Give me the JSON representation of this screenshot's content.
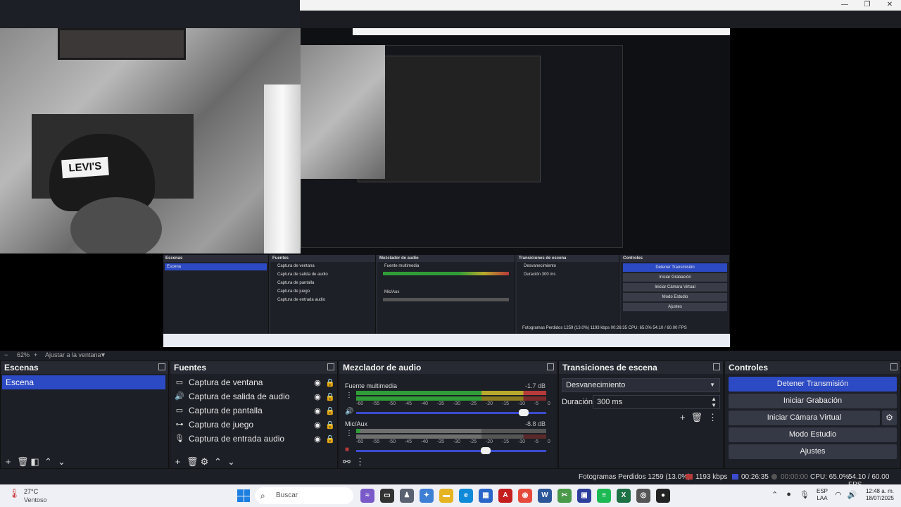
{
  "window": {
    "minimize": "—",
    "maximize": "❐",
    "close": "✕"
  },
  "preview": {
    "webcam_badge": "LEVI'S",
    "nested_docks": {
      "scenes_title": "Escenas",
      "scene": "Escena",
      "sources_title": "Fuentes",
      "sources": [
        "Captura de ventana",
        "Captura de salida de audio",
        "Captura de pantalla",
        "Captura de juego",
        "Captura de entrada audio"
      ],
      "mixer_title": "Mezclador de audio",
      "mixer_channels": [
        "Fuente multimedia",
        "Mic/Aux"
      ],
      "transitions_title": "Transiciones de escena",
      "transition": "Desvanecimiento",
      "duration": "Duración  300 ms",
      "controls_title": "Controles",
      "controls": [
        "Detener Transmisión",
        "Iniciar Grabación",
        "Iniciar Cámara Virtual",
        "Modo Estudio",
        "Ajustes"
      ],
      "status": "Fotogramas Perdidos 1259 (13.0%)   1193 kbps   00:26:35   CPU: 65.0%  54.10 / 60.00 FPS"
    }
  },
  "zoombar": {
    "minus": "−",
    "zoom": "62%",
    "plus": "+",
    "fit": "Ajustar a la ventana",
    "caret": "▼"
  },
  "scenes": {
    "title": "Escenas",
    "items": [
      "Escena"
    ]
  },
  "sources": {
    "title": "Fuentes",
    "items": [
      {
        "label": "Captura de ventana",
        "icon": "window-icon"
      },
      {
        "label": "Captura de salida de audio",
        "icon": "speaker-icon"
      },
      {
        "label": "Captura de pantalla",
        "icon": "monitor-icon"
      },
      {
        "label": "Captura de juego",
        "icon": "gamepad-icon"
      },
      {
        "label": "Captura de entrada audio",
        "icon": "microphone-icon"
      }
    ]
  },
  "mixer": {
    "title": "Mezclador de audio",
    "ticks": [
      "-60",
      "-55",
      "-50",
      "-45",
      "-40",
      "-35",
      "-30",
      "-25",
      "-20",
      "-15",
      "-10",
      "-5",
      "0"
    ],
    "channels": [
      {
        "name": "Fuente multimedia",
        "db": "-1.7 dB",
        "volume": 0.88
      },
      {
        "name": "Mic/Aux",
        "db": "-8.8 dB",
        "volume": 0.68
      }
    ]
  },
  "transitions": {
    "title": "Transiciones de escena",
    "selected": "Desvanecimiento",
    "duration_label": "Duración",
    "duration_value": "300 ms"
  },
  "controls": {
    "title": "Controles",
    "stop_stream": "Detener Transmisión",
    "start_recording": "Iniciar Grabación",
    "start_virtual_cam": "Iniciar Cámara Virtual",
    "studio_mode": "Modo Estudio",
    "settings": "Ajustes"
  },
  "status": {
    "dropped": "Fotogramas Perdidos 1259 (13.0%)",
    "kbps": "1193 kbps",
    "stream_time": "00:26:35",
    "rec_time": "00:00:00",
    "cpu": "CPU: 65.0%",
    "fps": "54.10 / 60.00 FPS"
  },
  "taskbar": {
    "temp": "27°C",
    "weather": "Ventoso",
    "search": "Buscar",
    "lang_1": "ESP",
    "lang_2": "LAA",
    "time": "12:48 a. m.",
    "date": "18/07/2025"
  },
  "colors": {
    "accent": "#2c4ac4",
    "meter_green": "#2f9d37",
    "meter_yellow": "#b8a92c",
    "meter_red": "#b73a3a"
  }
}
